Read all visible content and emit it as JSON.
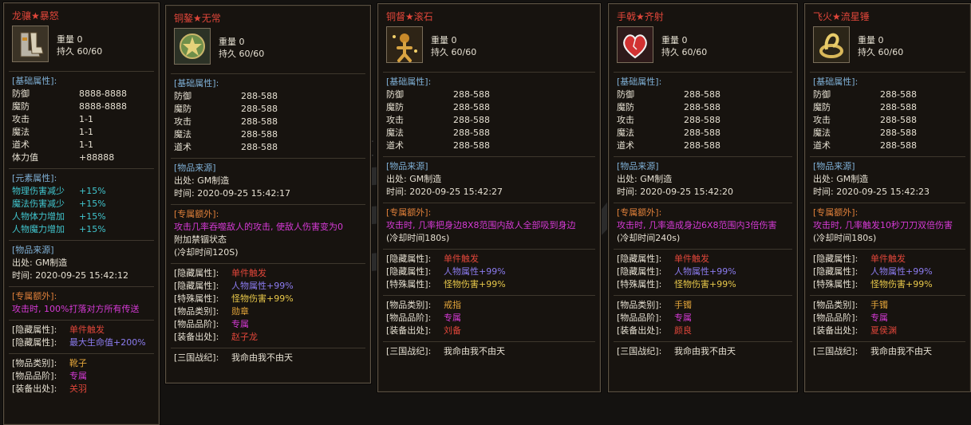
{
  "colors": {
    "title": "#e0463a",
    "cyan": "#41c6cf",
    "magenta": "#d63ad6",
    "violet": "#8c7cf0",
    "yellow": "#e8c84a",
    "red": "#e0463a"
  },
  "watermark": {
    "site": "980cq"
  },
  "cards": [
    {
      "title": "龙骧★暴怒",
      "icon": "boots-icon",
      "weight": "重量 0",
      "durability": "持久 60/60",
      "base_label": "[基础属性]:",
      "base": [
        [
          "防御",
          "8888-8888"
        ],
        [
          "魔防",
          "8888-8888"
        ],
        [
          "攻击",
          "1-1"
        ],
        [
          "魔法",
          "1-1"
        ],
        [
          "道术",
          "1-1"
        ],
        [
          "体力值",
          "+88888"
        ]
      ],
      "elem_label": "[元素属性]:",
      "elements": [
        [
          "物理伤害减少",
          "+15%"
        ],
        [
          "魔法伤害减少",
          "+15%"
        ],
        [
          "人物体力增加",
          "+15%"
        ],
        [
          "人物魔力增加",
          "+15%"
        ]
      ],
      "source_label": "[物品来源]",
      "origin": "出处: GM制造",
      "time": "时间: 2020-09-25 15:42:12",
      "extra_label": "[专属额外]:",
      "extra": "攻击时, 100%打落对方所有传送",
      "hidden": [
        [
          "[隐藏属性]:",
          "单件触发"
        ],
        [
          "[隐藏属性]:",
          "最大生命值+200%"
        ]
      ],
      "info": [
        [
          "[物品类别]:",
          "靴子"
        ],
        [
          "[物品品阶]:",
          "专属"
        ],
        [
          "[装备出处]:",
          "关羽"
        ]
      ]
    },
    {
      "title": "铜鏊★无常",
      "icon": "medal-icon",
      "weight": "重量 0",
      "durability": "持久 60/60",
      "base_label": "[基础属性]:",
      "base": [
        [
          "防御",
          "288-588"
        ],
        [
          "魔防",
          "288-588"
        ],
        [
          "攻击",
          "288-588"
        ],
        [
          "魔法",
          "288-588"
        ],
        [
          "道术",
          "288-588"
        ]
      ],
      "source_label": "[物品来源]",
      "origin": "出处: GM制造",
      "time": "时间: 2020-09-25 15:42:17",
      "extra_label": "[专属额外]:",
      "extra": "攻击几率吞噬敌人的攻击, 使敌人伤害变为0",
      "extra2": "附加禁锢状态",
      "cooldown": "(冷却时间120S)",
      "hidden": [
        [
          "[隐藏属性]:",
          "单件触发"
        ],
        [
          "[隐藏属性]:",
          "人物属性+99%"
        ],
        [
          "[特殊属性]:",
          "怪物伤害+99%"
        ]
      ],
      "info": [
        [
          "[物品类别]:",
          "勋章"
        ],
        [
          "[物品品阶]:",
          "专属"
        ],
        [
          "[装备出处]:",
          "赵子龙"
        ]
      ],
      "footer": [
        "[三国战纪]:",
        "我命由我不由天"
      ]
    },
    {
      "title": "铜督★滚石",
      "icon": "ring-icon",
      "weight": "重量 0",
      "durability": "持久 60/60",
      "base_label": "[基础属性]:",
      "base": [
        [
          "防御",
          "288-588"
        ],
        [
          "魔防",
          "288-588"
        ],
        [
          "攻击",
          "288-588"
        ],
        [
          "魔法",
          "288-588"
        ],
        [
          "道术",
          "288-588"
        ]
      ],
      "source_label": "[物品来源]",
      "origin": "出处: GM制造",
      "time": "时间: 2020-09-25 15:42:27",
      "extra_label": "[专属额外]:",
      "extra": "攻击时, 几率把身边8X8范围内敌人全部吸到身边",
      "cooldown": "(冷却时间180s)",
      "hidden": [
        [
          "[隐藏属性]:",
          "单件触发"
        ],
        [
          "[隐藏属性]:",
          "人物属性+99%"
        ],
        [
          "[特殊属性]:",
          "怪物伤害+99%"
        ]
      ],
      "info": [
        [
          "[物品类别]:",
          "戒指"
        ],
        [
          "[物品品阶]:",
          "专属"
        ],
        [
          "[装备出处]:",
          "刘备"
        ]
      ],
      "footer": [
        "[三国战纪]:",
        "我命由我不由天"
      ]
    },
    {
      "title": "手戟★齐射",
      "icon": "heart-bracelet-icon",
      "weight": "重量 0",
      "durability": "持久 60/60",
      "base_label": "[基础属性]:",
      "base": [
        [
          "防御",
          "288-588"
        ],
        [
          "魔防",
          "288-588"
        ],
        [
          "攻击",
          "288-588"
        ],
        [
          "魔法",
          "288-588"
        ],
        [
          "道术",
          "288-588"
        ]
      ],
      "source_label": "[物品来源]",
      "origin": "出处: GM制造",
      "time": "时间: 2020-09-25 15:42:20",
      "extra_label": "[专属额外]:",
      "extra": "攻击时, 几率造成身边6X8范围内3倍伤害",
      "cooldown": "(冷却时间240s)",
      "hidden": [
        [
          "[隐藏属性]:",
          "单件触发"
        ],
        [
          "[隐藏属性]:",
          "人物属性+99%"
        ],
        [
          "[特殊属性]:",
          "怪物伤害+99%"
        ]
      ],
      "info": [
        [
          "[物品类别]:",
          "手镯"
        ],
        [
          "[物品品阶]:",
          "专属"
        ],
        [
          "[装备出处]:",
          "颜良"
        ]
      ],
      "footer": [
        "[三国战纪]:",
        "我命由我不由天"
      ]
    },
    {
      "title": "飞火★流星锤",
      "icon": "bracelet-icon",
      "weight": "重量 0",
      "durability": "持久 60/60",
      "base_label": "[基础属性]:",
      "base": [
        [
          "防御",
          "288-588"
        ],
        [
          "魔防",
          "288-588"
        ],
        [
          "攻击",
          "288-588"
        ],
        [
          "魔法",
          "288-588"
        ],
        [
          "道术",
          "288-588"
        ]
      ],
      "source_label": "[物品来源]",
      "origin": "出处: GM制造",
      "time": "时间: 2020-09-25 15:42:23",
      "extra_label": "[专属额外]:",
      "extra": "攻击时, 几率触发10秒刀刀双倍伤害",
      "cooldown": "(冷却时间180s)",
      "hidden": [
        [
          "[隐藏属性]:",
          "单件触发"
        ],
        [
          "[隐藏属性]:",
          "人物属性+99%"
        ],
        [
          "[特殊属性]:",
          "怪物伤害+99%"
        ]
      ],
      "info": [
        [
          "[物品类别]:",
          "手镯"
        ],
        [
          "[物品品阶]:",
          "专属"
        ],
        [
          "[装备出处]:",
          "夏侯渊"
        ]
      ],
      "footer": [
        "[三国战纪]:",
        "我命由我不由天"
      ]
    }
  ]
}
